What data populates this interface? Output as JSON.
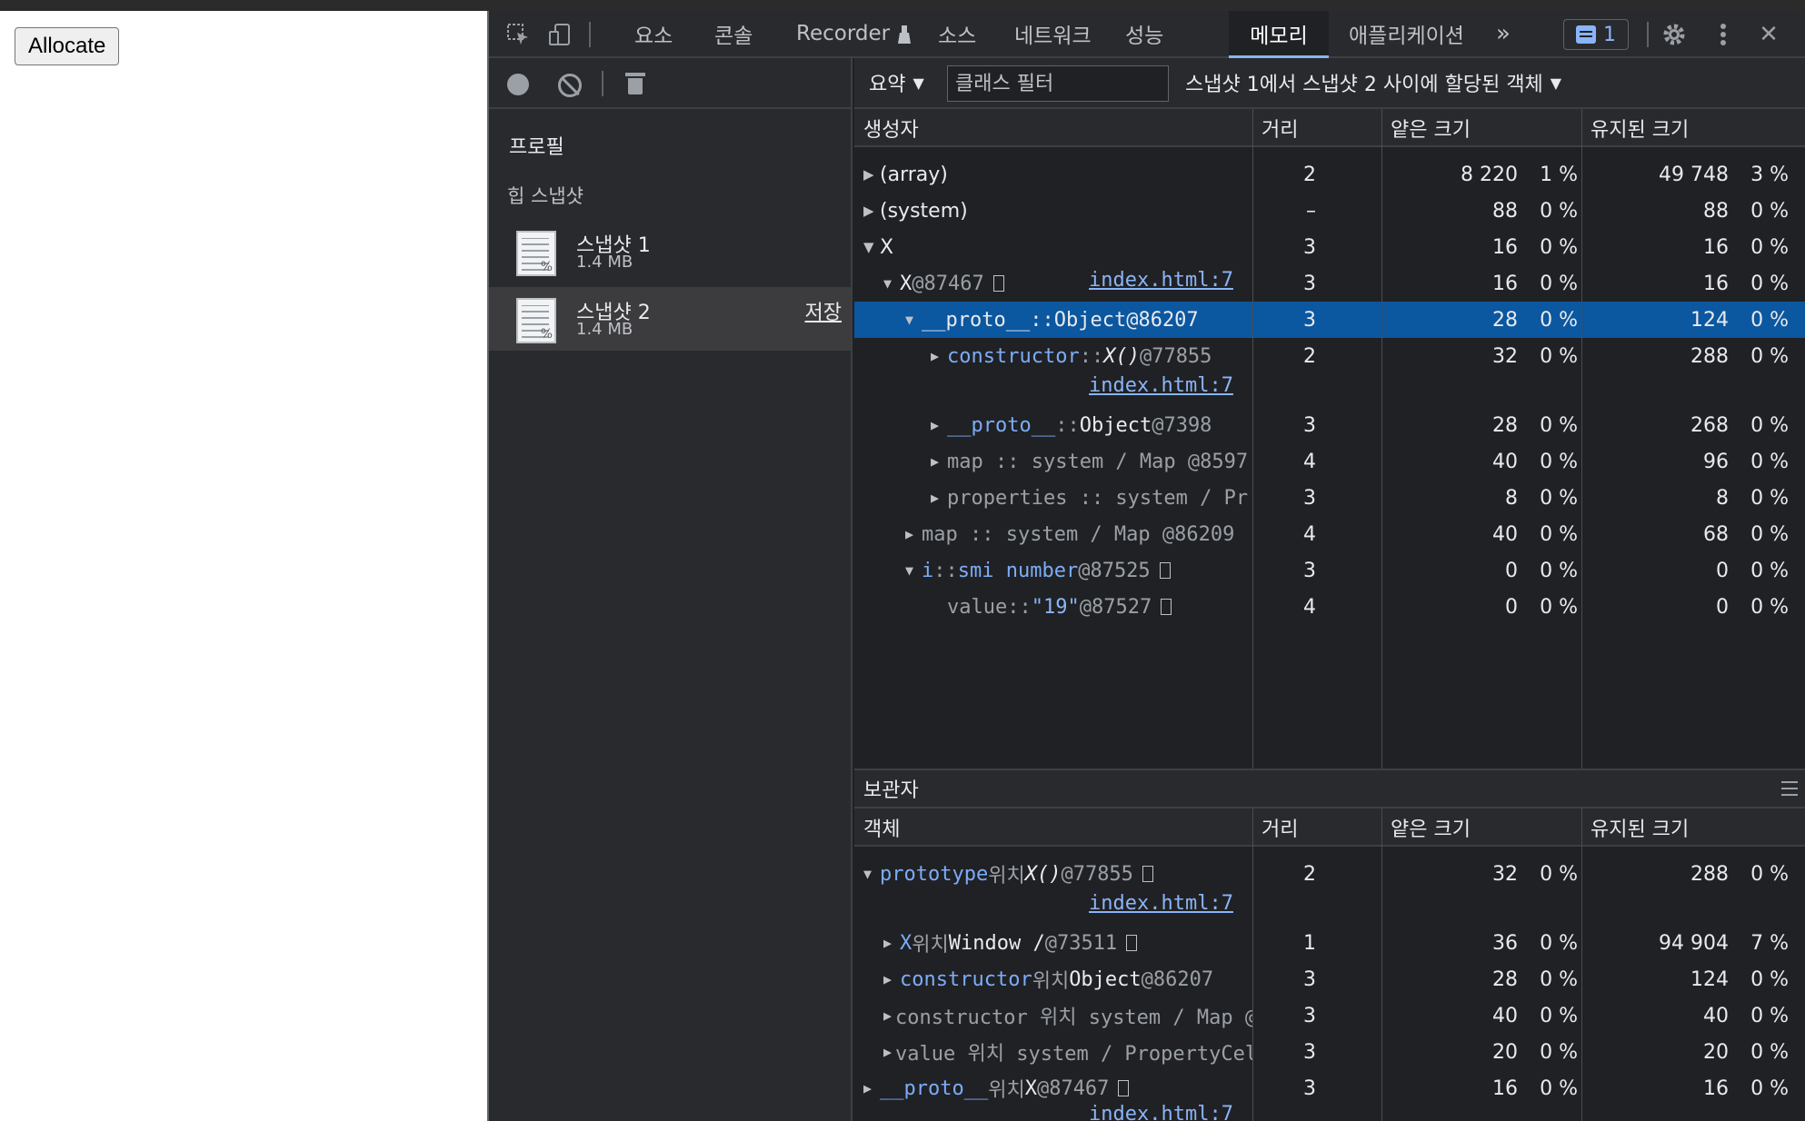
{
  "page": {
    "allocate_label": "Allocate"
  },
  "toolbar": {
    "tabs": [
      "요소",
      "콘솔",
      "Recorder",
      "소스",
      "네트워크",
      "성능",
      "메모리",
      "애플리케이션"
    ],
    "more": "»",
    "issues_count": "1",
    "close": "✕"
  },
  "sidebar": {
    "profiles_heading": "프로필",
    "heap_heading": "힙 스냅샷",
    "snapshots": [
      {
        "name": "스냅샷 1",
        "size": "1.4 MB"
      },
      {
        "name": "스냅샷 2",
        "size": "1.4 MB",
        "save": "저장"
      }
    ]
  },
  "filterbar": {
    "view": "요약",
    "class_filter_placeholder": "클래스 필터",
    "range": "스냅샷 1에서 스냅샷 2 사이에 할당된 객체"
  },
  "columns": {
    "constructor": "생성자",
    "object": "객체",
    "distance": "거리",
    "shallow": "얕은 크기",
    "retained": "유지된 크기"
  },
  "rows": [
    {
      "label": "(array)",
      "dist": "2",
      "sh": "8 220",
      "shp": "1 %",
      "rt": "49 748",
      "rtp": "3 %"
    },
    {
      "label": "(system)",
      "dist": "–",
      "sh": "88",
      "shp": "0 %",
      "rt": "88",
      "rtp": "0 %"
    },
    {
      "label": "X",
      "dist": "3",
      "sh": "16",
      "shp": "0 %",
      "rt": "16",
      "rtp": "0 %"
    },
    {
      "label": "X",
      "id": "@87467",
      "link": "index.html:7",
      "dist": "3",
      "sh": "16",
      "shp": "0 %",
      "rt": "16",
      "rtp": "0 %"
    },
    {
      "name": "__proto__",
      "sep": "::",
      "type": "Object",
      "id": "@86207",
      "dist": "3",
      "sh": "28",
      "shp": "0 %",
      "rt": "124",
      "rtp": "0 %"
    },
    {
      "name": "constructor",
      "sep": "::",
      "type": "X()",
      "id": "@77855",
      "link": "index.html:7",
      "dist": "2",
      "sh": "32",
      "shp": "0 %",
      "rt": "288",
      "rtp": "0 %"
    },
    {
      "name": "__proto__",
      "sep": "::",
      "type": "Object",
      "id": "@7398",
      "dist": "3",
      "sh": "28",
      "shp": "0 %",
      "rt": "268",
      "rtp": "0 %"
    },
    {
      "text": "map :: system / Map @8597",
      "dist": "4",
      "sh": "40",
      "shp": "0 %",
      "rt": "96",
      "rtp": "0 %"
    },
    {
      "text": "properties :: system / Pr",
      "dist": "3",
      "sh": "8",
      "shp": "0 %",
      "rt": "8",
      "rtp": "0 %"
    },
    {
      "text": "map :: system / Map @86209",
      "dist": "4",
      "sh": "40",
      "shp": "0 %",
      "rt": "68",
      "rtp": "0 %"
    },
    {
      "name": "i",
      "sep": "::",
      "type": "smi number",
      "id": "@87525",
      "dist": "3",
      "sh": "0",
      "shp": "0 %",
      "rt": "0",
      "rtp": "0 %"
    },
    {
      "name": "value",
      "sep": "::",
      "type": "\"19\"",
      "id": "@87527",
      "dist": "4",
      "sh": "0",
      "shp": "0 %",
      "rt": "0",
      "rtp": "0 %"
    }
  ],
  "retainers": {
    "title": "보관자",
    "rows": [
      {
        "name": "prototype",
        "mid": "위치",
        "type": "X()",
        "id": "@77855",
        "link": "index.html:7",
        "dist": "2",
        "sh": "32",
        "shp": "0 %",
        "rt": "288",
        "rtp": "0 %"
      },
      {
        "name": "X",
        "mid": "위치",
        "type": "Window /",
        "id": "@73511",
        "dist": "1",
        "sh": "36",
        "shp": "0 %",
        "rt": "94 904",
        "rtp": "7 %"
      },
      {
        "name": "constructor",
        "mid": "위치",
        "type": "Object",
        "id": "@86207",
        "dist": "3",
        "sh": "28",
        "shp": "0 %",
        "rt": "124",
        "rtp": "0 %"
      },
      {
        "text": "constructor 위치 system / Map @",
        "dist": "3",
        "sh": "40",
        "shp": "0 %",
        "rt": "40",
        "rtp": "0 %"
      },
      {
        "text": "value 위치 system / PropertyCel",
        "dist": "3",
        "sh": "20",
        "shp": "0 %",
        "rt": "20",
        "rtp": "0 %"
      },
      {
        "name": "__proto__",
        "mid": "위치",
        "type": "X",
        "id": "@87467",
        "link": "index.html:7",
        "dist": "3",
        "sh": "16",
        "shp": "0 %",
        "rt": "16",
        "rtp": "0 %"
      }
    ]
  }
}
